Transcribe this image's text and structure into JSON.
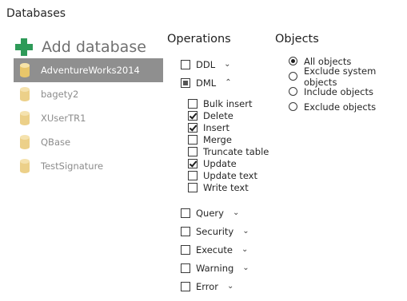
{
  "page": {
    "title": "Databases"
  },
  "add_database": {
    "label": "Add database",
    "icon": "plus-icon",
    "color": "#2e9a58"
  },
  "databases": [
    {
      "name": "AdventureWorks2014",
      "selected": true
    },
    {
      "name": "bagety2",
      "selected": false
    },
    {
      "name": "XUserTR1",
      "selected": false
    },
    {
      "name": "QBase",
      "selected": false
    },
    {
      "name": "TestSignature",
      "selected": false
    }
  ],
  "operations": {
    "header": "Operations",
    "groups": {
      "ddl": {
        "label": "DDL",
        "state": "unchecked",
        "chevron": "⌄"
      },
      "dml": {
        "label": "DML",
        "state": "partial",
        "chevron": "⌃"
      },
      "query": {
        "label": "Query",
        "state": "unchecked",
        "chevron": "⌄"
      },
      "security": {
        "label": "Security",
        "state": "unchecked",
        "chevron": "⌄"
      },
      "execute": {
        "label": "Execute",
        "state": "unchecked",
        "chevron": "⌄"
      },
      "warning": {
        "label": "Warning",
        "state": "unchecked",
        "chevron": "⌄"
      },
      "error": {
        "label": "Error",
        "state": "unchecked",
        "chevron": "⌄"
      }
    },
    "dml_items": [
      {
        "label": "Bulk insert",
        "checked": false
      },
      {
        "label": "Delete",
        "checked": true
      },
      {
        "label": "Insert",
        "checked": true
      },
      {
        "label": "Merge",
        "checked": false
      },
      {
        "label": "Truncate table",
        "checked": false
      },
      {
        "label": "Update",
        "checked": true
      },
      {
        "label": "Update text",
        "checked": false
      },
      {
        "label": "Write text",
        "checked": false
      }
    ]
  },
  "objects": {
    "header": "Objects",
    "options": [
      {
        "label": "All objects",
        "selected": true
      },
      {
        "label": "Exclude system objects",
        "selected": false
      },
      {
        "label": "Include objects",
        "selected": false
      },
      {
        "label": "Exclude objects",
        "selected": false
      }
    ]
  },
  "colors": {
    "selected_row": "#8f8f8f",
    "db_icon": "#e8c66a"
  }
}
